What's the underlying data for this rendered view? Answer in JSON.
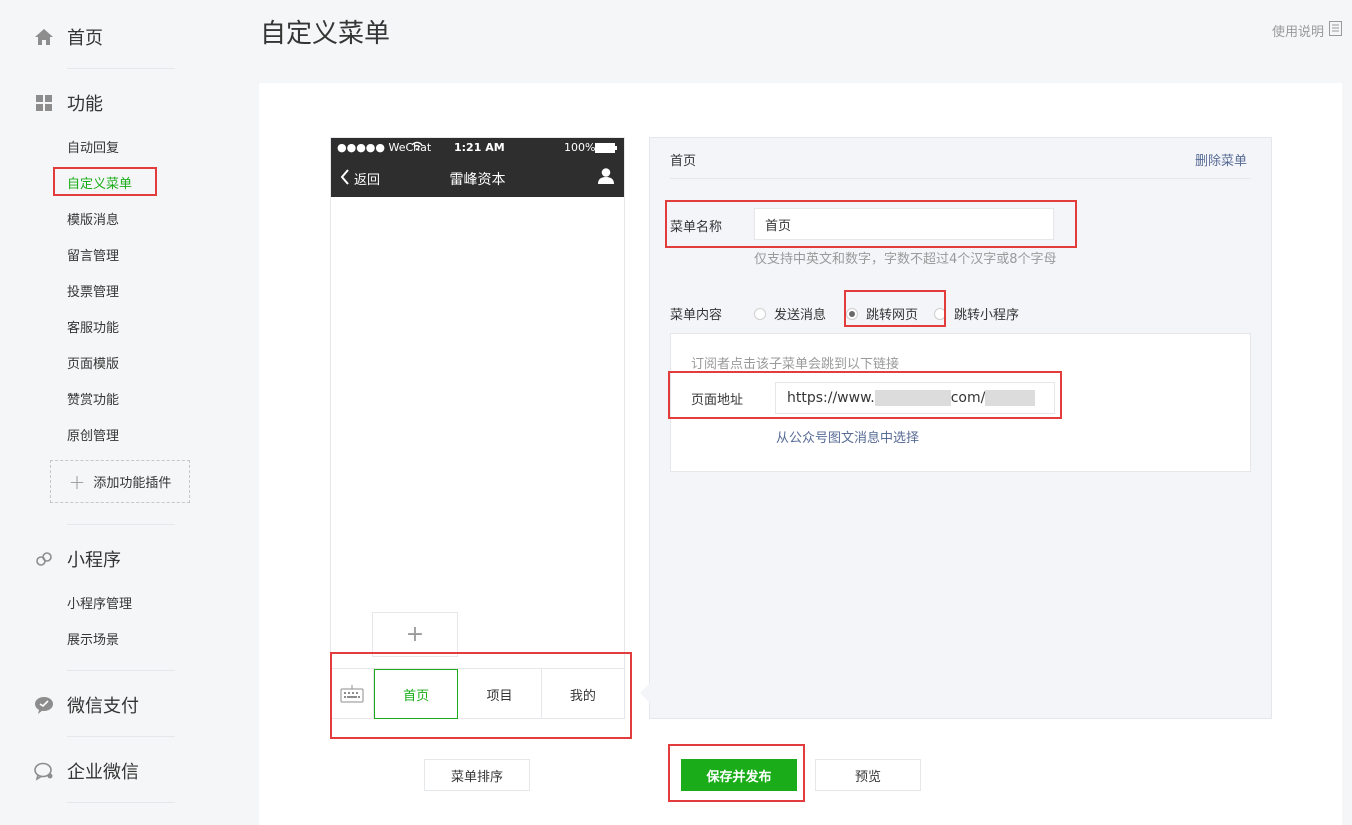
{
  "sidebar": {
    "home": "首页",
    "features": "功能",
    "feature_items": [
      "自动回复",
      "自定义菜单",
      "模版消息",
      "留言管理",
      "投票管理",
      "客服功能",
      "页面模版",
      "赞赏功能",
      "原创管理"
    ],
    "add_plugin": "添加功能插件",
    "miniprogram": "小程序",
    "mini_items": [
      "小程序管理",
      "展示场景"
    ],
    "pay": "微信支付",
    "work": "企业微信"
  },
  "header": {
    "title": "自定义菜单",
    "help": "使用说明"
  },
  "phone": {
    "carrier": "●●●●● WeChat",
    "time": "1:21 AM",
    "battery": "100%",
    "back": "返回",
    "account_name": "雷峰资本",
    "menu_tabs": [
      "首页",
      "项目",
      "我的"
    ],
    "add_sub": "+"
  },
  "editor": {
    "section_title": "首页",
    "delete": "删除菜单",
    "name_label": "菜单名称",
    "name_value": "首页",
    "name_hint": "仅支持中英文和数字，字数不超过4个汉字或8个字母",
    "content_label": "菜单内容",
    "options": [
      "发送消息",
      "跳转网页",
      "跳转小程序"
    ],
    "sub_desc": "订阅者点击该子菜单会跳到以下链接",
    "url_label": "页面地址",
    "url_prefix": "https://www.",
    "url_mid": "com/",
    "select_link": "从公众号图文消息中选择"
  },
  "buttons": {
    "sort": "菜单排序",
    "save": "保存并发布",
    "preview": "预览"
  },
  "colors": {
    "accent": "#1aad19",
    "highlight": "#e33c3c"
  }
}
